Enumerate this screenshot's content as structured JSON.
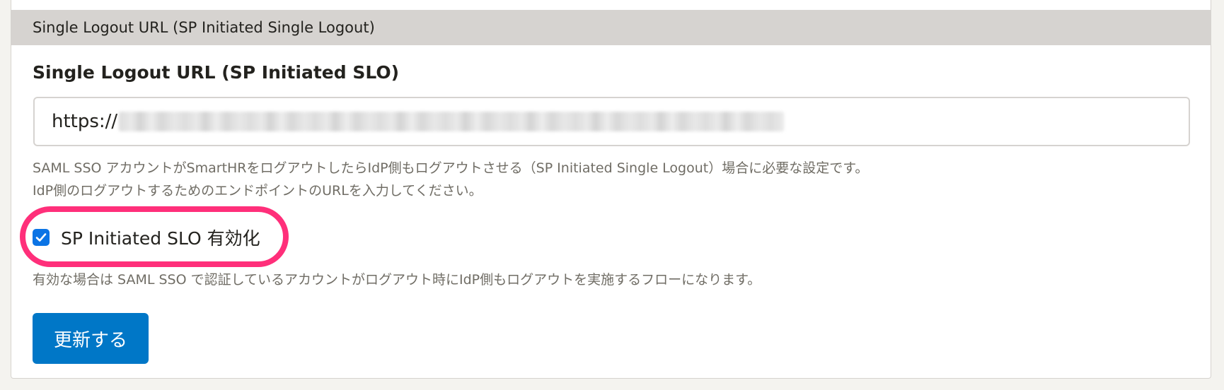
{
  "section": {
    "header": "Single Logout URL (SP Initiated Single Logout)"
  },
  "field": {
    "label": "Single Logout URL (SP Initiated SLO)",
    "value_prefix": "https://"
  },
  "help": {
    "line1": "SAML SSO アカウントがSmartHRをログアウトしたらIdP側もログアウトさせる（SP Initiated Single Logout）場合に必要な設定です。",
    "line2": "IdP側のログアウトするためのエンドポイントのURLを入力してください。"
  },
  "checkbox": {
    "label": "SP Initiated SLO 有効化",
    "checked": true
  },
  "note": "有効な場合は SAML SSO で認証しているアカウントがログアウト時にIdP側もログアウトを実施するフローになります。",
  "button": {
    "label": "更新する"
  },
  "colors": {
    "accent": "#0077c7",
    "checkbox": "#0b74e5",
    "highlight": "#ff2f7a",
    "header_bg": "#d6d3d0"
  }
}
